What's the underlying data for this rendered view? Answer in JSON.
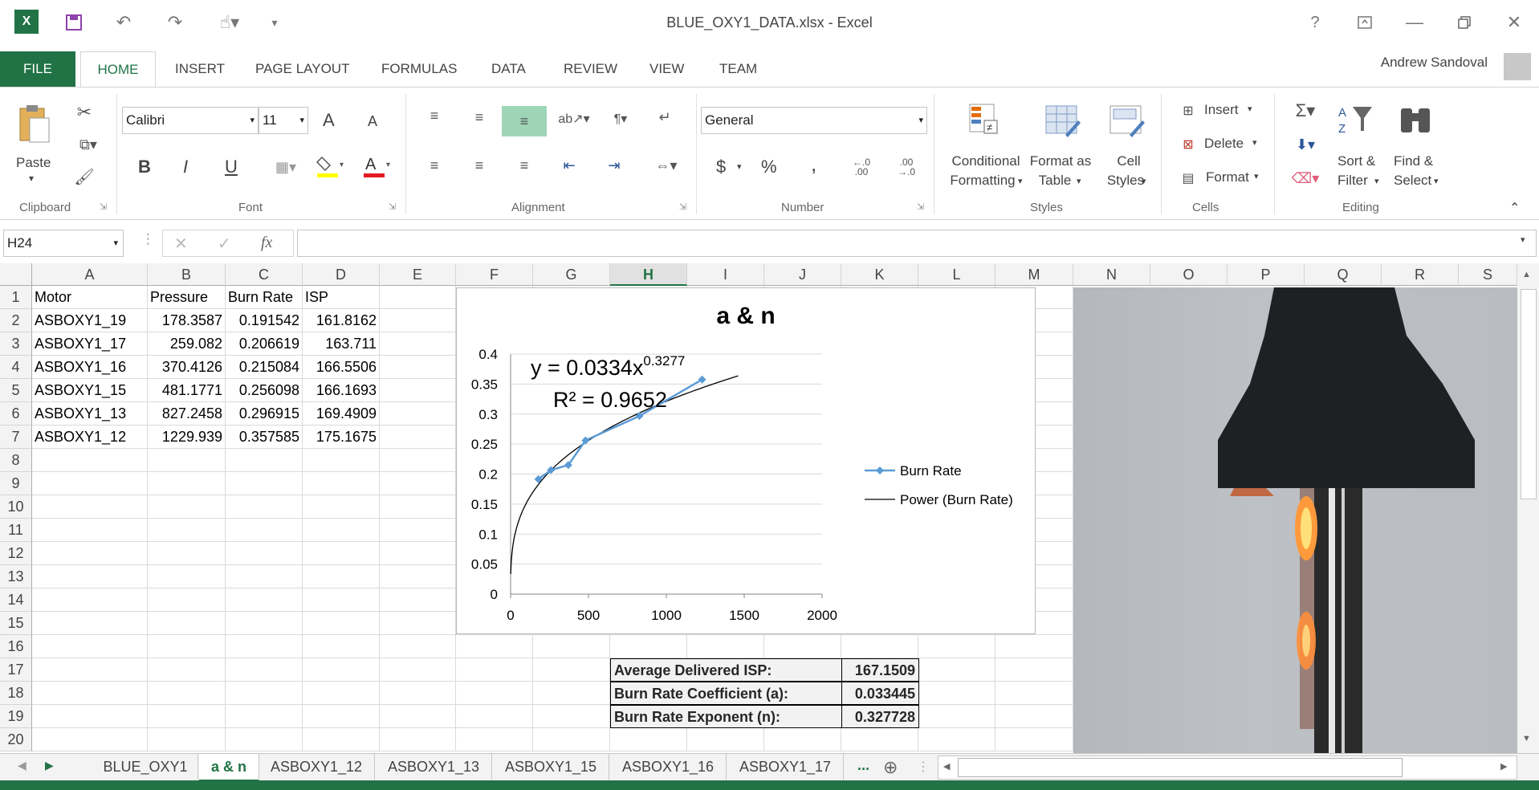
{
  "window": {
    "title": "BLUE_OXY1_DATA.xlsx - Excel",
    "help": "?",
    "qat_more": "▾"
  },
  "ribbon_tabs": [
    "FILE",
    "HOME",
    "INSERT",
    "PAGE LAYOUT",
    "FORMULAS",
    "DATA",
    "REVIEW",
    "VIEW",
    "TEAM"
  ],
  "user": "Andrew Sandoval",
  "clipboard": {
    "paste": "Paste",
    "group": "Clipboard"
  },
  "font": {
    "name": "Calibri",
    "size": "11",
    "bold": "B",
    "italic": "I",
    "underline": "U",
    "group": "Font",
    "grow": "A",
    "shrink": "A",
    "color_letter": "A"
  },
  "alignment": {
    "group": "Alignment"
  },
  "number": {
    "format": "General",
    "currency": "$",
    "percent": "%",
    "comma": ",",
    "inc": "←.0\n.00",
    "dec": ".00\n→.0",
    "group": "Number"
  },
  "styles": {
    "cond_1": "Conditional",
    "cond_2": "Formatting",
    "table_1": "Format as",
    "table_2": "Table",
    "cell_1": "Cell",
    "cell_2": "Styles",
    "group": "Styles"
  },
  "cells": {
    "insert": "Insert",
    "delete": "Delete",
    "format": "Format",
    "group": "Cells"
  },
  "editing": {
    "sort_1": "Sort &",
    "sort_2": "Filter",
    "find_1": "Find &",
    "find_2": "Select",
    "group": "Editing"
  },
  "formula_bar": {
    "name_box": "H24",
    "fx": "fx",
    "value": ""
  },
  "columns": [
    "A",
    "B",
    "C",
    "D",
    "E",
    "F",
    "G",
    "H",
    "I",
    "J",
    "K",
    "L",
    "M",
    "N",
    "O",
    "P",
    "Q",
    "R",
    "S"
  ],
  "rows": [
    "1",
    "2",
    "3",
    "4",
    "5",
    "6",
    "7",
    "8",
    "9",
    "10",
    "11",
    "12",
    "13",
    "14",
    "15",
    "16",
    "17",
    "18",
    "19",
    "20"
  ],
  "table": {
    "headers": [
      "Motor",
      "Pressure",
      "Burn Rate",
      "ISP"
    ],
    "rows": [
      [
        "ASBOXY1_19",
        "178.3587",
        "0.191542",
        "161.8162"
      ],
      [
        "ASBOXY1_17",
        "259.082",
        "0.206619",
        "163.711"
      ],
      [
        "ASBOXY1_16",
        "370.4126",
        "0.215084",
        "166.5506"
      ],
      [
        "ASBOXY1_15",
        "481.1771",
        "0.256098",
        "166.1693"
      ],
      [
        "ASBOXY1_13",
        "827.2458",
        "0.296915",
        "169.4909"
      ],
      [
        "ASBOXY1_12",
        "1229.939",
        "0.357585",
        "175.1675"
      ]
    ]
  },
  "summary": [
    {
      "label": "Average Delivered ISP:",
      "value": "167.1509"
    },
    {
      "label": "Burn Rate Coefficient (a):",
      "value": "0.033445"
    },
    {
      "label": "Burn Rate Exponent (n):",
      "value": "0.327728"
    }
  ],
  "chart_data": {
    "type": "scatter",
    "title": "a & n",
    "xlim": [
      0,
      2000
    ],
    "ylim": [
      0,
      0.4
    ],
    "x_ticks": [
      "0",
      "500",
      "1000",
      "1500",
      "2000"
    ],
    "y_ticks": [
      "0",
      "0.05",
      "0.1",
      "0.15",
      "0.2",
      "0.25",
      "0.3",
      "0.35",
      "0.4"
    ],
    "grid": true,
    "legend_position": "right",
    "series": [
      {
        "name": "Burn Rate",
        "color": "#5b9bd5",
        "x": [
          178.3587,
          259.082,
          370.4126,
          481.1771,
          827.2458,
          1229.939
        ],
        "y": [
          0.191542,
          0.206619,
          0.215084,
          0.256098,
          0.296915,
          0.357585
        ]
      },
      {
        "name": "Power (Burn Rate)",
        "color": "#000000",
        "trendline": {
          "a": 0.0334,
          "n": 0.3277,
          "x_range": [
            0,
            1460
          ]
        }
      }
    ],
    "equation_main": "y = 0.0334x",
    "equation_exp": "0.3277",
    "r_squared": "R² = 0.9652"
  },
  "sheet_tabs": [
    "BLUE_OXY1",
    "a & n",
    "ASBOXY1_12",
    "ASBOXY1_13",
    "ASBOXY1_15",
    "ASBOXY1_16",
    "ASBOXY1_17"
  ],
  "sheet_more": "...",
  "colors": {
    "excel_green": "#217346",
    "series_blue": "#5b9bd5"
  }
}
